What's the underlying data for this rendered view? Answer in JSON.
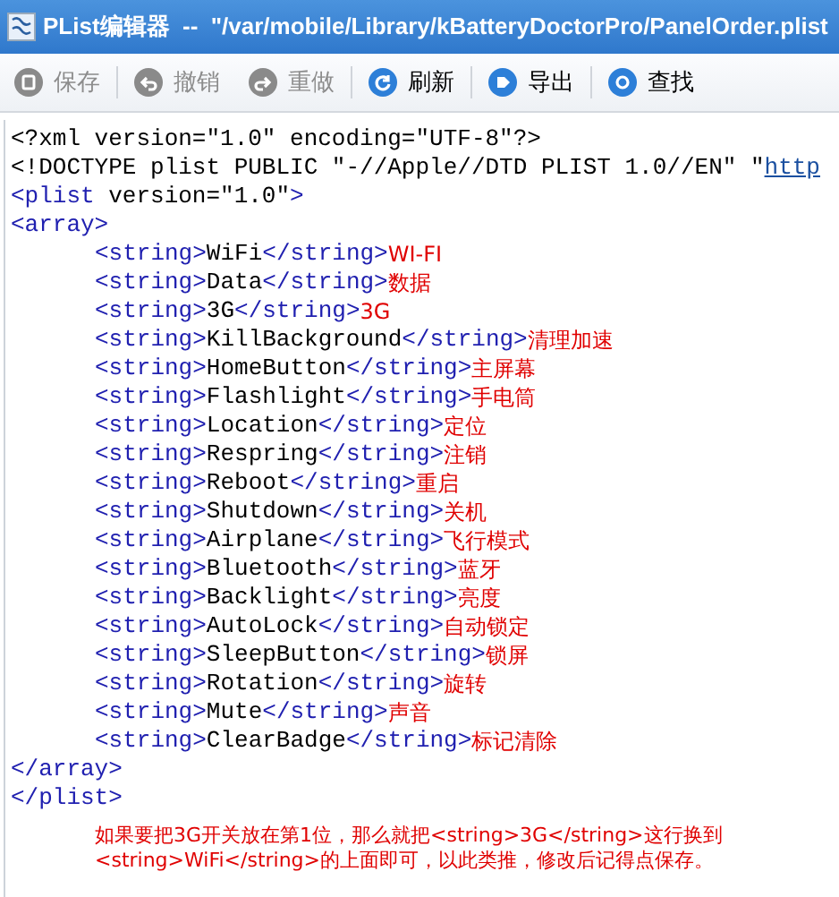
{
  "window": {
    "title": "PList编辑器  --  \"/var/mobile/Library/kBatteryDoctorPro/PanelOrder.plist"
  },
  "toolbar": [
    {
      "label": "保存",
      "kind": "save",
      "disabled": true
    },
    {
      "label": "撤销",
      "kind": "undo",
      "disabled": true
    },
    {
      "label": "重做",
      "kind": "redo",
      "disabled": true
    },
    {
      "label": "刷新",
      "kind": "refresh",
      "disabled": false
    },
    {
      "label": "导出",
      "kind": "export",
      "disabled": false
    },
    {
      "label": "查找",
      "kind": "find",
      "disabled": false
    }
  ],
  "editor": {
    "head": [
      [
        {
          "kind": "text",
          "text": "<?xml version=\"1.0\" encoding=\"UTF-8\"?>"
        }
      ],
      [
        {
          "kind": "text",
          "text": "<!DOCTYPE plist PUBLIC \"-//Apple//DTD PLIST 1.0//EN\" \""
        },
        {
          "kind": "link",
          "text": "http"
        }
      ],
      [
        {
          "kind": "tag",
          "text": "<plist "
        },
        {
          "kind": "text",
          "text": "version=\"1.0\""
        },
        {
          "kind": "tag",
          "text": ">"
        }
      ],
      [
        {
          "kind": "tag",
          "text": "<array>"
        }
      ]
    ],
    "items": [
      {
        "open": "<string>",
        "value": "WiFi",
        "close": "</string>",
        "note": "WI-FI"
      },
      {
        "open": "<string>",
        "value": "Data",
        "close": "</string>",
        "note": "数据"
      },
      {
        "open": "<string>",
        "value": "3G",
        "close": "</string>",
        "note": "3G"
      },
      {
        "open": "<string>",
        "value": "KillBackground",
        "close": "</string>",
        "note": "清理加速"
      },
      {
        "open": "<string>",
        "value": "HomeButton",
        "close": "</string>",
        "note": "主屏幕"
      },
      {
        "open": "<string>",
        "value": "Flashlight",
        "close": "</string>",
        "note": "手电筒"
      },
      {
        "open": "<string>",
        "value": "Location",
        "close": "</string>",
        "note": "定位"
      },
      {
        "open": "<string>",
        "value": "Respring",
        "close": "</string>",
        "note": "注销"
      },
      {
        "open": "<string>",
        "value": "Reboot",
        "close": "</string>",
        "note": "重启"
      },
      {
        "open": "<string>",
        "value": "Shutdown",
        "close": "</string>",
        "note": "关机"
      },
      {
        "open": "<string>",
        "value": "Airplane",
        "close": "</string>",
        "note": "飞行模式"
      },
      {
        "open": "<string>",
        "value": "Bluetooth",
        "close": "</string>",
        "note": "蓝牙"
      },
      {
        "open": "<string>",
        "value": "Backlight",
        "close": "</string>",
        "note": "亮度"
      },
      {
        "open": "<string>",
        "value": "AutoLock",
        "close": "</string>",
        "note": "自动锁定"
      },
      {
        "open": "<string>",
        "value": "SleepButton",
        "close": "</string>",
        "note": "锁屏"
      },
      {
        "open": "<string>",
        "value": "Rotation",
        "close": "</string>",
        "note": "旋转"
      },
      {
        "open": "<string>",
        "value": "Mute",
        "close": "</string>",
        "note": "声音"
      },
      {
        "open": "<string>",
        "value": "ClearBadge",
        "close": "</string>",
        "note": "标记清除"
      }
    ],
    "tail": [
      "</array>",
      "</plist>"
    ],
    "note": [
      "如果要把3G开关放在第1位，那么就把<string>3G</string>这行换到",
      "<string>WiFi</string>的上面即可，以此类推，修改后记得点保存。"
    ]
  }
}
